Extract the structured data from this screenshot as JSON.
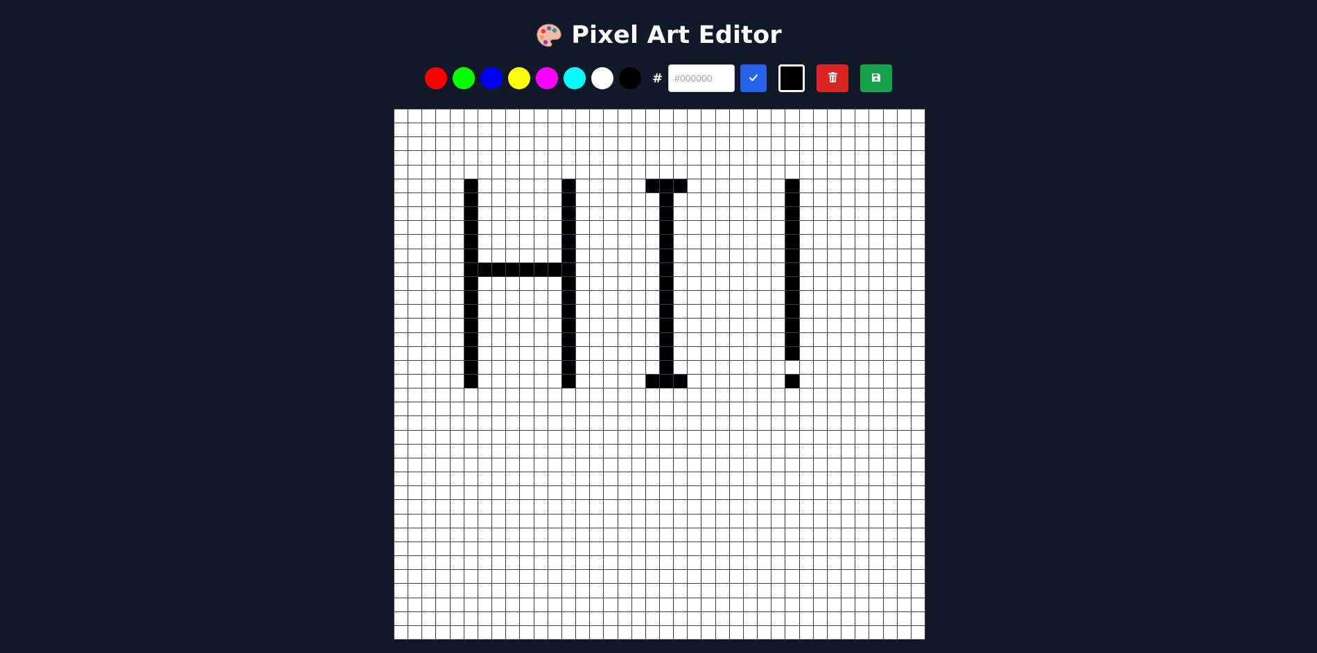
{
  "header": {
    "title": "Pixel Art Editor",
    "icon": "palette-icon"
  },
  "toolbar": {
    "swatches": [
      {
        "name": "red",
        "color": "#ff0000"
      },
      {
        "name": "green",
        "color": "#00ff00"
      },
      {
        "name": "blue",
        "color": "#0000ff"
      },
      {
        "name": "yellow",
        "color": "#ffff00"
      },
      {
        "name": "magenta",
        "color": "#ff00ff"
      },
      {
        "name": "cyan",
        "color": "#00ffff"
      },
      {
        "name": "white",
        "color": "#ffffff"
      },
      {
        "name": "black",
        "color": "#000000"
      }
    ],
    "hash_label": "#",
    "hex_input": {
      "value": "",
      "placeholder": "#000000"
    },
    "apply_icon": "check-icon",
    "current_color": "#000000",
    "clear_icon": "trash-icon",
    "save_icon": "save-icon"
  },
  "canvas": {
    "columns": 38,
    "rows": 38,
    "background": "#ffffff",
    "paint_color": "#000000",
    "filled_cells": [
      [
        5,
        5
      ],
      [
        5,
        6
      ],
      [
        5,
        7
      ],
      [
        5,
        8
      ],
      [
        5,
        9
      ],
      [
        5,
        10
      ],
      [
        5,
        11
      ],
      [
        5,
        12
      ],
      [
        5,
        13
      ],
      [
        5,
        14
      ],
      [
        5,
        15
      ],
      [
        5,
        16
      ],
      [
        5,
        17
      ],
      [
        5,
        18
      ],
      [
        5,
        19
      ],
      [
        6,
        11
      ],
      [
        7,
        11
      ],
      [
        8,
        11
      ],
      [
        9,
        11
      ],
      [
        10,
        11
      ],
      [
        11,
        11
      ],
      [
        12,
        5
      ],
      [
        12,
        6
      ],
      [
        12,
        7
      ],
      [
        12,
        8
      ],
      [
        12,
        9
      ],
      [
        12,
        10
      ],
      [
        12,
        11
      ],
      [
        12,
        12
      ],
      [
        12,
        13
      ],
      [
        12,
        14
      ],
      [
        12,
        15
      ],
      [
        12,
        16
      ],
      [
        12,
        17
      ],
      [
        12,
        18
      ],
      [
        12,
        19
      ],
      [
        18,
        5
      ],
      [
        19,
        5
      ],
      [
        20,
        5
      ],
      [
        19,
        6
      ],
      [
        19,
        7
      ],
      [
        19,
        8
      ],
      [
        19,
        9
      ],
      [
        19,
        10
      ],
      [
        19,
        11
      ],
      [
        19,
        12
      ],
      [
        19,
        13
      ],
      [
        19,
        14
      ],
      [
        19,
        15
      ],
      [
        19,
        16
      ],
      [
        19,
        17
      ],
      [
        19,
        18
      ],
      [
        18,
        19
      ],
      [
        19,
        19
      ],
      [
        20,
        19
      ],
      [
        28,
        5
      ],
      [
        28,
        6
      ],
      [
        28,
        7
      ],
      [
        28,
        8
      ],
      [
        28,
        9
      ],
      [
        28,
        10
      ],
      [
        28,
        11
      ],
      [
        28,
        12
      ],
      [
        28,
        13
      ],
      [
        28,
        14
      ],
      [
        28,
        15
      ],
      [
        28,
        16
      ],
      [
        28,
        17
      ],
      [
        28,
        19
      ]
    ]
  }
}
